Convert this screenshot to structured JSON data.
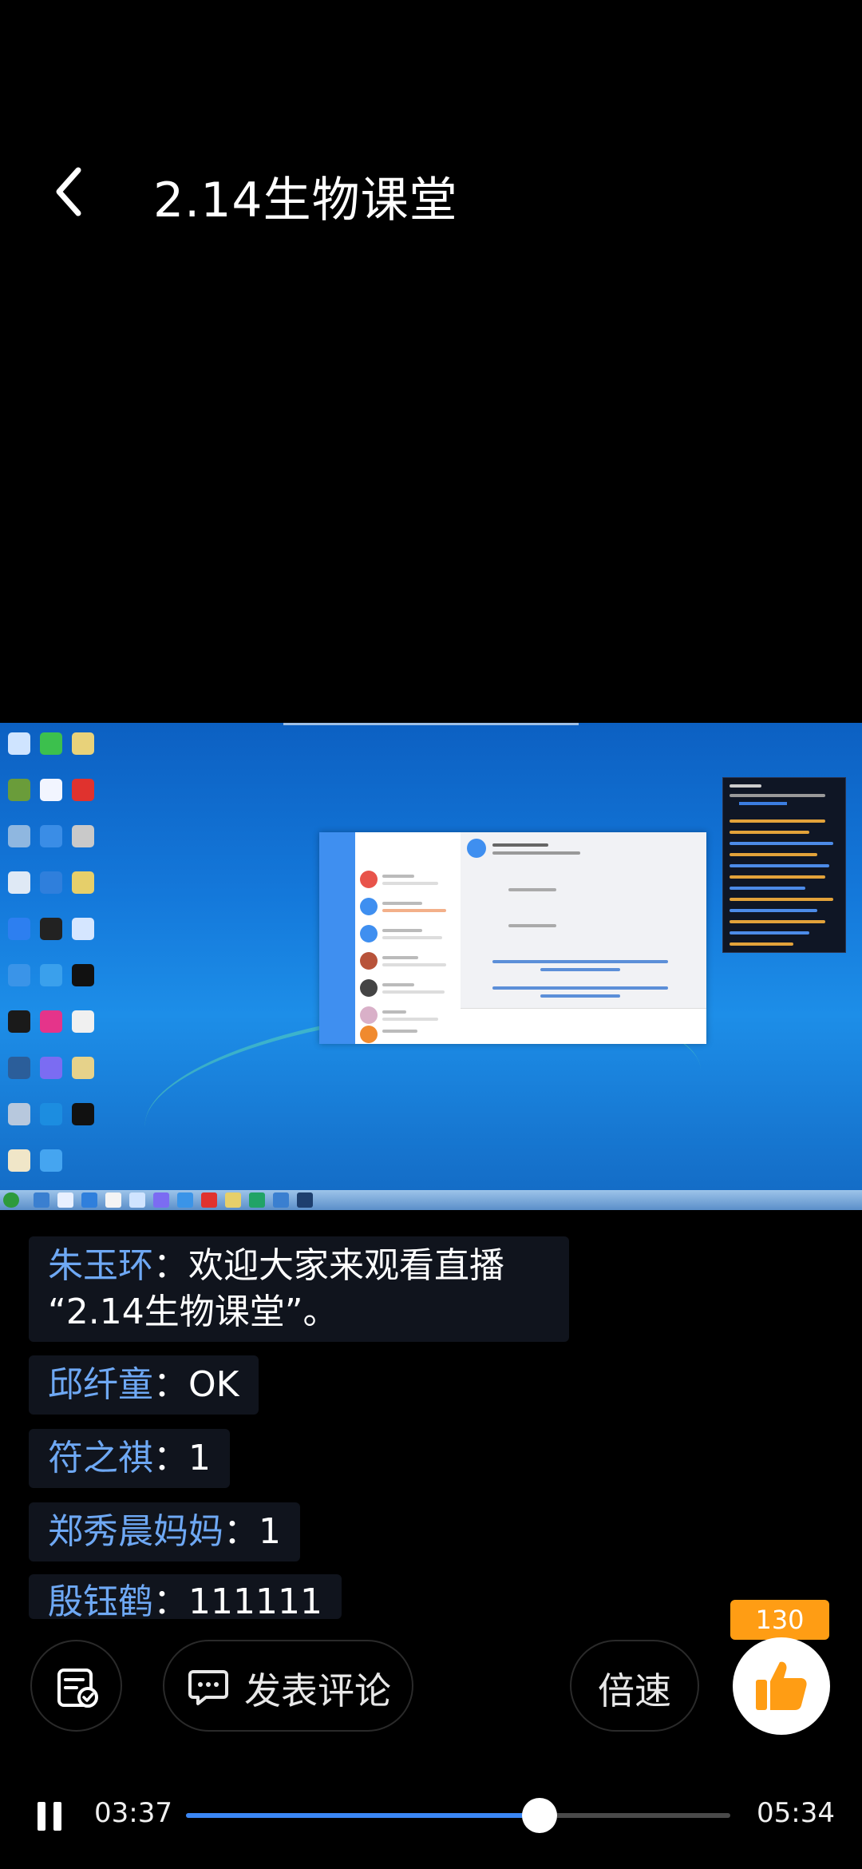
{
  "header": {
    "title": "2.14生物课堂"
  },
  "comments": [
    {
      "name": "朱玉环",
      "sep": "：",
      "line1": "欢迎大家来观看直播",
      "line2": "“2.14生物课堂”。"
    },
    {
      "name": "邱纤童",
      "sep": "：",
      "text": "OK"
    },
    {
      "name": "符之祺",
      "sep": "：",
      "text": "1"
    },
    {
      "name": "郑秀晨妈妈",
      "sep": "：",
      "text": "1"
    },
    {
      "name": "殷钰鹤",
      "sep": "：",
      "text": "111111"
    }
  ],
  "actions": {
    "notes_icon": "notes-edit-icon",
    "comment_label": "发表评论",
    "comment_icon": "chat-bubble-icon",
    "speed_label": "倍速",
    "like_count": "130",
    "like_icon": "thumbs-up-icon"
  },
  "playback": {
    "current_time": "03:37",
    "total_time": "05:34",
    "progress": 0.65,
    "state_icon": "pause-icon"
  },
  "colors": {
    "accent": "#3a86f4",
    "username": "#6ea8f4",
    "like_badge": "#ff9d14",
    "like_icon": "#ff9d14"
  }
}
